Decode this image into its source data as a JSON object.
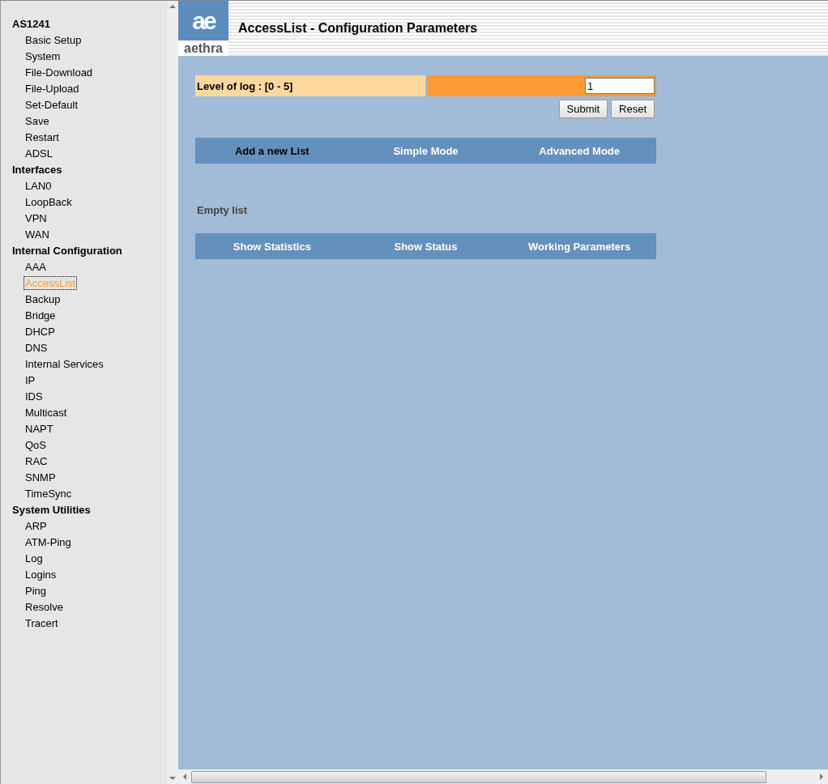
{
  "sidebar": {
    "groups": [
      {
        "title": "AS1241",
        "items": [
          {
            "label": "Basic Setup",
            "selected": false
          },
          {
            "label": "System",
            "selected": false
          },
          {
            "label": "File-Download",
            "selected": false
          },
          {
            "label": "File-Upload",
            "selected": false
          },
          {
            "label": "Set-Default",
            "selected": false
          },
          {
            "label": "Save",
            "selected": false
          },
          {
            "label": "Restart",
            "selected": false
          },
          {
            "label": "ADSL",
            "selected": false
          }
        ]
      },
      {
        "title": "Interfaces",
        "items": [
          {
            "label": "LAN0",
            "selected": false
          },
          {
            "label": "LoopBack",
            "selected": false
          },
          {
            "label": "VPN",
            "selected": false
          },
          {
            "label": "WAN",
            "selected": false
          }
        ]
      },
      {
        "title": "Internal Configuration",
        "items": [
          {
            "label": "AAA",
            "selected": false
          },
          {
            "label": "AccessList",
            "selected": true
          },
          {
            "label": "Backup",
            "selected": false
          },
          {
            "label": "Bridge",
            "selected": false
          },
          {
            "label": "DHCP",
            "selected": false
          },
          {
            "label": "DNS",
            "selected": false
          },
          {
            "label": "Internal Services",
            "selected": false
          },
          {
            "label": "IP",
            "selected": false
          },
          {
            "label": "IDS",
            "selected": false
          },
          {
            "label": "Multicast",
            "selected": false
          },
          {
            "label": "NAPT",
            "selected": false
          },
          {
            "label": "QoS",
            "selected": false
          },
          {
            "label": "RAC",
            "selected": false
          },
          {
            "label": "SNMP",
            "selected": false
          },
          {
            "label": "TimeSync",
            "selected": false
          }
        ]
      },
      {
        "title": "System Utilities",
        "items": [
          {
            "label": "ARP",
            "selected": false
          },
          {
            "label": "ATM-Ping",
            "selected": false
          },
          {
            "label": "Log",
            "selected": false
          },
          {
            "label": "Logins",
            "selected": false
          },
          {
            "label": "Ping",
            "selected": false
          },
          {
            "label": "Resolve",
            "selected": false
          },
          {
            "label": "Tracert",
            "selected": false
          }
        ]
      }
    ]
  },
  "header": {
    "logo_mark": "ae",
    "logo_name": "aethra",
    "title": "AccessList - Configuration Parameters"
  },
  "log_level": {
    "label": "Level of log : [0 - 5]",
    "value": "1"
  },
  "buttons": [
    "Submit",
    "Reset"
  ],
  "tabs": [
    {
      "label": "Add a new List",
      "selected": true
    },
    {
      "label": "Simple Mode",
      "selected": false
    },
    {
      "label": "Advanced Mode",
      "selected": false
    }
  ],
  "list_status": "Empty list",
  "bottom_links": [
    "Show Statistics",
    "Show Status",
    "Working Parameters"
  ]
}
